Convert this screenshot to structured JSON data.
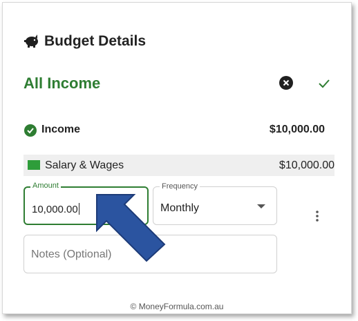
{
  "header": {
    "title": "Budget Details",
    "icon": "piggy-bank-icon"
  },
  "section": {
    "title": "All Income",
    "cancel_icon": "cancel-icon",
    "confirm_icon": "check-icon"
  },
  "income": {
    "label": "Income",
    "amount": "$10,000.00",
    "icon": "check-circle-icon"
  },
  "category": {
    "label": "Salary & Wages",
    "amount": "$10,000.00",
    "color": "#2e9d3a"
  },
  "form": {
    "amount_label": "Amount",
    "amount_value": "10,000.00",
    "frequency_label": "Frequency",
    "frequency_value": "Monthly",
    "notes_placeholder": "Notes (Optional)"
  },
  "footer": {
    "text": "© MoneyFormula.com.au"
  },
  "colors": {
    "accent": "#2e7d32",
    "arrow": "#2b54a0"
  }
}
